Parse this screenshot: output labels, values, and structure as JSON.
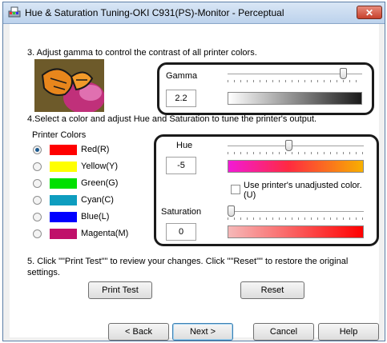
{
  "window": {
    "title": "Hue & Saturation Tuning-OKI C931(PS)-Monitor - Perceptual",
    "close_symbol": "✕"
  },
  "step3": {
    "instruction": "3. Adjust gamma to control the contrast of all printer colors."
  },
  "gamma": {
    "label": "Gamma",
    "value": "2.2",
    "slider_level": 0.88
  },
  "step4": {
    "instruction": "4.Select a color and adjust Hue and Saturation to tune the printer's output."
  },
  "printer_colors": {
    "heading": "Printer Colors",
    "items": [
      {
        "label": "Red(R)",
        "color": "#ff0000",
        "selected": true
      },
      {
        "label": "Yellow(Y)",
        "color": "#ffff00",
        "selected": false
      },
      {
        "label": "Green(G)",
        "color": "#00e000",
        "selected": false
      },
      {
        "label": "Cyan(C)",
        "color": "#0e9dbf",
        "selected": false
      },
      {
        "label": "Blue(L)",
        "color": "#0000ff",
        "selected": false
      },
      {
        "label": "Magenta(M)",
        "color": "#c0106a",
        "selected": false
      }
    ]
  },
  "hue": {
    "label": "Hue",
    "value": "-5",
    "slider_level": 0.45
  },
  "unadjusted": {
    "label_line1": "Use printer's unadjusted color.",
    "label_line2": "(U)",
    "checked": false
  },
  "saturation": {
    "label": "Saturation",
    "value": "0",
    "slider_level": 0.0
  },
  "step5": {
    "line1": "5. Click \"\"Print Test\"\" to review your changes. Click \"\"Reset\"\" to restore the original",
    "line2": "settings."
  },
  "buttons": {
    "print_test": "Print Test",
    "reset": "Reset",
    "back": "< Back",
    "next": "Next >",
    "cancel": "Cancel",
    "help": "Help"
  },
  "icons": {
    "app": "printer-color-icon",
    "close": "close-icon",
    "preview": "butterfly-image"
  },
  "colors": {
    "gamma_bar_start": "#ffffff",
    "gamma_bar_end": "#1a1a1a",
    "hue_bar_start": "#f21ad6",
    "hue_bar_end": "#f7b000",
    "sat_bar_start": "#f6b8b8",
    "sat_bar_end": "#ff0000"
  }
}
